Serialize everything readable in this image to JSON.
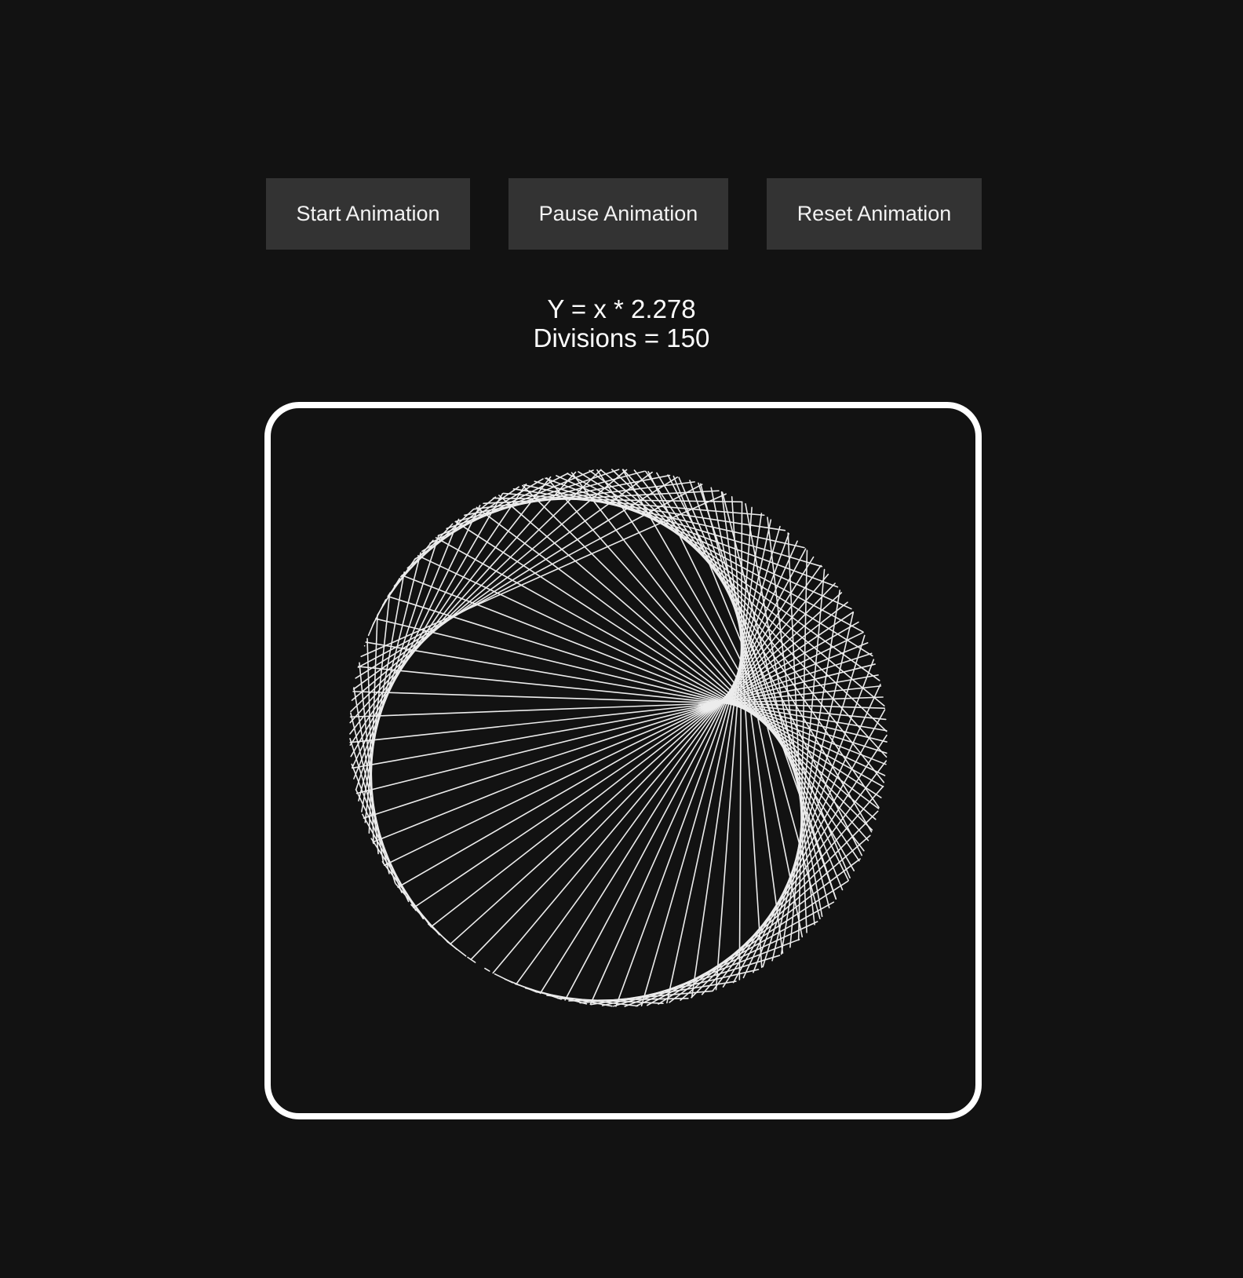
{
  "controls": {
    "start_label": "Start Animation",
    "pause_label": "Pause Animation",
    "reset_label": "Reset Animation"
  },
  "info": {
    "equation": "Y = x * 2.278",
    "divisions_text": "Divisions = 150"
  },
  "pattern": {
    "multiplier": 2.278,
    "divisions": 150,
    "line_color": "#ffffff",
    "background_color": "#121212",
    "frame_color": "#ffffff"
  },
  "colors": {
    "page_background": "#121212",
    "button_background": "#333333",
    "button_text": "#f2f2f2"
  }
}
